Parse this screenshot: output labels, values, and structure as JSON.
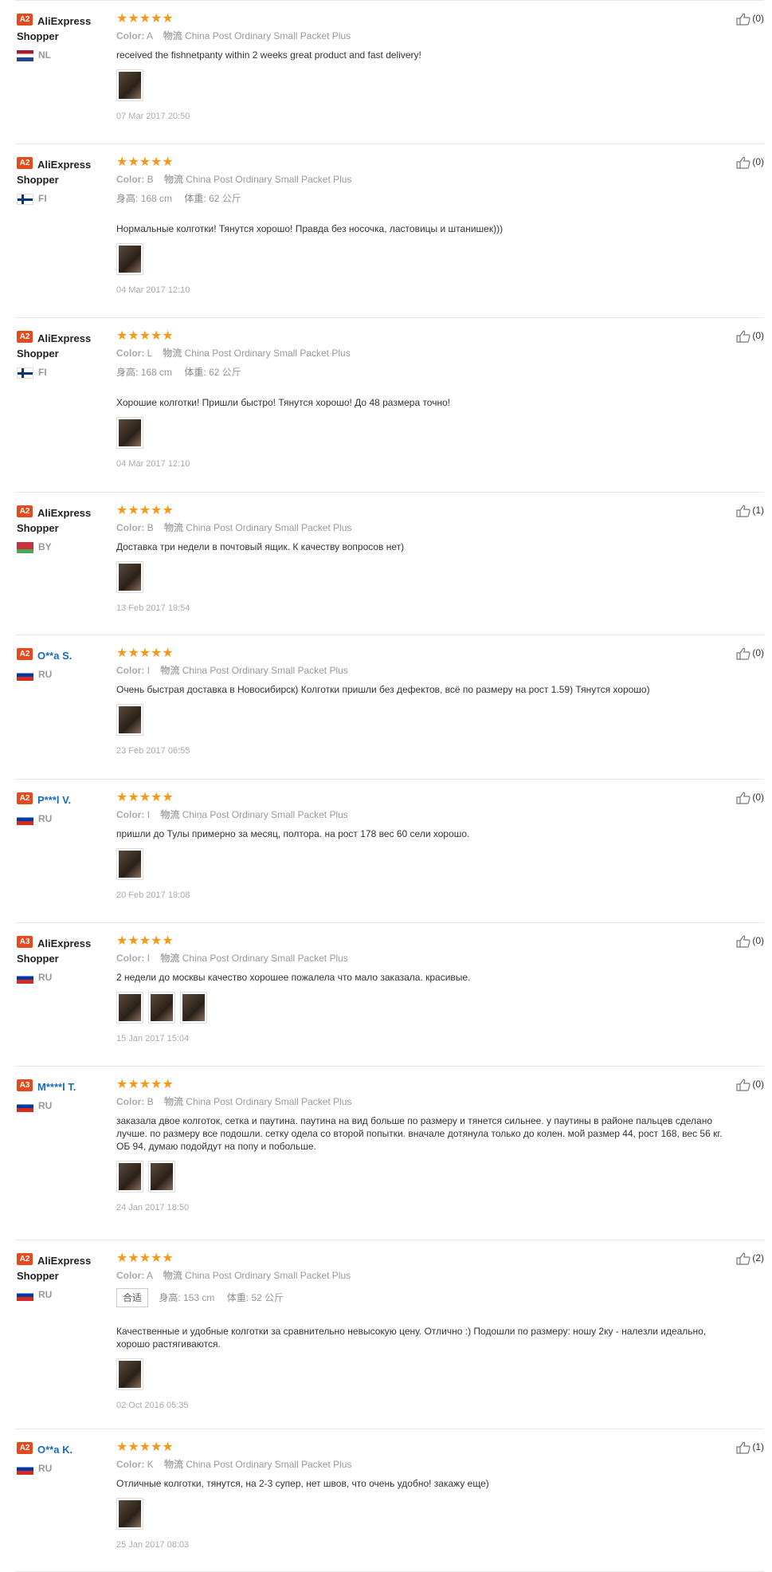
{
  "reviews": [
    {
      "level": "A2",
      "name": "AliExpress Shopper",
      "masked": false,
      "flag": "nl",
      "country": "NL",
      "stars": "★★★★★",
      "color_label": "Color:",
      "color": "A",
      "ship_label": "物流",
      "shipping": "China Post Ordinary Small Packet Plus",
      "height_label": "",
      "height": "",
      "weight_label": "",
      "weight": "",
      "fit": "",
      "text": "received the fishnetpanty within 2 weeks great product and fast delivery!",
      "thumbs": 1,
      "date": "07 Mar 2017 20:50",
      "likes": "(0)"
    },
    {
      "level": "A2",
      "name": "AliExpress Shopper",
      "masked": false,
      "flag": "fi",
      "country": "FI",
      "stars": "★★★★★",
      "color_label": "Color:",
      "color": "B",
      "ship_label": "物流",
      "shipping": "China Post Ordinary Small Packet Plus",
      "height_label": "身高:",
      "height": "168 cm",
      "weight_label": "体重:",
      "weight": "62 公斤",
      "fit": "",
      "text": "Нормальные колготки! Тянутся хорошо! Правда без носочка, ластовицы и штанишек)))",
      "thumbs": 1,
      "date": "04 Mar 2017 12:10",
      "likes": "(0)"
    },
    {
      "level": "A2",
      "name": "AliExpress Shopper",
      "masked": false,
      "flag": "fi",
      "country": "FI",
      "stars": "★★★★★",
      "color_label": "Color:",
      "color": "L",
      "ship_label": "物流",
      "shipping": "China Post Ordinary Small Packet Plus",
      "height_label": "身高:",
      "height": "168 cm",
      "weight_label": "体重:",
      "weight": "62 公斤",
      "fit": "",
      "text": "Хорошие колготки! Пришли быстро! Тянутся хорошо! До 48 размера точно!",
      "thumbs": 1,
      "date": "04 Mar 2017 12:10",
      "likes": "(0)"
    },
    {
      "level": "A2",
      "name": "AliExpress Shopper",
      "masked": false,
      "flag": "by",
      "country": "BY",
      "stars": "★★★★★",
      "color_label": "Color:",
      "color": "B",
      "ship_label": "物流",
      "shipping": "China Post Ordinary Small Packet Plus",
      "height_label": "",
      "height": "",
      "weight_label": "",
      "weight": "",
      "fit": "",
      "text": "Доставка три недели в почтовый ящик. К качеству вопросов нет)",
      "thumbs": 1,
      "date": "13 Feb 2017 19:54",
      "likes": "(1)"
    },
    {
      "level": "A2",
      "name": "O**a S.",
      "masked": true,
      "flag": "ru",
      "country": "RU",
      "stars": "★★★★★",
      "color_label": "Color:",
      "color": "I",
      "ship_label": "物流",
      "shipping": "China Post Ordinary Small Packet Plus",
      "height_label": "",
      "height": "",
      "weight_label": "",
      "weight": "",
      "fit": "",
      "text": "Очень быстрая доставка в Новосибирск) Колготки пришли без дефектов, всё по размеру на рост 1.59) Тянутся хорошо)",
      "thumbs": 1,
      "date": "23 Feb 2017 06:55",
      "likes": "(0)"
    },
    {
      "level": "A2",
      "name": "P***l V.",
      "masked": true,
      "flag": "ru",
      "country": "RU",
      "stars": "★★★★★",
      "color_label": "Color:",
      "color": "I",
      "ship_label": "物流",
      "shipping": "China Post Ordinary Small Packet Plus",
      "height_label": "",
      "height": "",
      "weight_label": "",
      "weight": "",
      "fit": "",
      "text": "пришли до Тулы примерно за месяц, полтора. на рост 178 вес 60 сели хорошо.",
      "thumbs": 1,
      "date": "20 Feb 2017 19:08",
      "likes": "(0)"
    },
    {
      "level": "A3",
      "name": "AliExpress Shopper",
      "masked": false,
      "flag": "ru",
      "country": "RU",
      "stars": "★★★★★",
      "color_label": "Color:",
      "color": "I",
      "ship_label": "物流",
      "shipping": "China Post Ordinary Small Packet Plus",
      "height_label": "",
      "height": "",
      "weight_label": "",
      "weight": "",
      "fit": "",
      "text": "2 недели до москвы качество хорошее пожалела что мало заказала. красивые.",
      "thumbs": 3,
      "date": "15 Jan 2017 15:04",
      "likes": "(0)"
    },
    {
      "level": "A3",
      "name": "M****l T.",
      "masked": true,
      "flag": "ru",
      "country": "RU",
      "stars": "★★★★★",
      "color_label": "Color:",
      "color": "B",
      "ship_label": "物流",
      "shipping": "China Post Ordinary Small Packet Plus",
      "height_label": "",
      "height": "",
      "weight_label": "",
      "weight": "",
      "fit": "",
      "text": "заказала двое колготок, сетка и паутина. паутина на вид больше по размеру и тянется сильнее. у паутины в районе пальцев сделано лучше. по размеру все подошли. сетку одела со второй попытки. вначале дотянула только до колен. мой размер 44, рост 168, вес 56 кг. ОБ 94, думаю подойдут на попу и побольше.",
      "thumbs": 2,
      "date": "24 Jan 2017 18:50",
      "likes": "(0)"
    },
    {
      "level": "A2",
      "name": "AliExpress Shopper",
      "masked": false,
      "flag": "ru",
      "country": "RU",
      "stars": "★★★★★",
      "color_label": "Color:",
      "color": "A",
      "ship_label": "物流",
      "shipping": "China Post Ordinary Small Packet Plus",
      "height_label": "身高:",
      "height": "153 cm",
      "weight_label": "体重:",
      "weight": "52 公斤",
      "fit": "合适",
      "text": "Качественные и удобные колготки за сравнительно невысокую цену. Отлично :) Подошли по размеру: ношу 2ку - налезли идеально, хорошо растягиваются.",
      "thumbs": 1,
      "date": "02 Oct 2016 05:35",
      "likes": "(2)"
    },
    {
      "level": "A2",
      "name": "O**a K.",
      "masked": true,
      "flag": "ru",
      "country": "RU",
      "stars": "★★★★★",
      "color_label": "Color:",
      "color": "K",
      "ship_label": "物流",
      "shipping": "China Post Ordinary Small Packet Plus",
      "height_label": "",
      "height": "",
      "weight_label": "",
      "weight": "",
      "fit": "",
      "text": "Отличные колготки, тянутся, на 2-3 супер, нет швов, что очень удобно! закажу еще)",
      "thumbs": 1,
      "date": "25 Jan 2017 08:03",
      "likes": "(1)"
    }
  ]
}
